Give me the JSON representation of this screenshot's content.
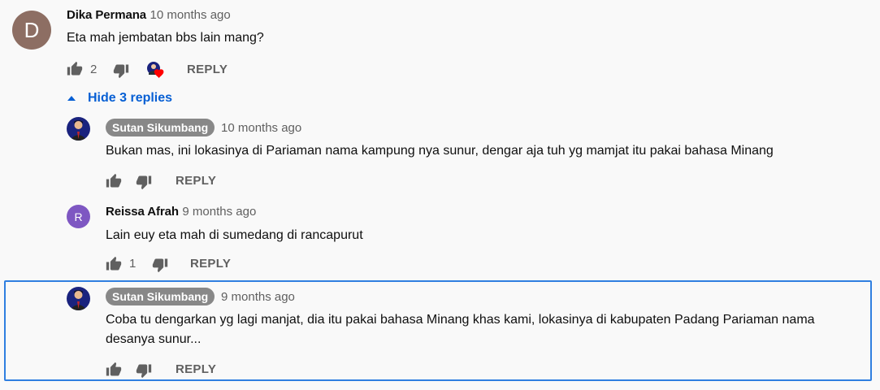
{
  "top_comment": {
    "avatar_letter": "D",
    "author": "Dika Permana",
    "time": "10 months ago",
    "text": "Eta mah jembatan bbs lain mang?",
    "likes": "2",
    "reply_label": "REPLY"
  },
  "hide_replies_label": "Hide 3 replies",
  "replies": [
    {
      "author": "Sutan Sikumbang",
      "time": "10 months ago",
      "text": "Bukan mas, ini lokasinya di Pariaman nama kampung nya sunur, dengar aja tuh yg mamjat itu pakai bahasa Minang",
      "reply_label": "REPLY"
    },
    {
      "avatar_letter": "R",
      "author": "Reissa Afrah",
      "time": "9 months ago",
      "text": "Lain euy eta mah di sumedang di rancapurut",
      "likes": "1",
      "reply_label": "REPLY"
    },
    {
      "author": "Sutan Sikumbang",
      "time": "9 months ago",
      "text_line1": "Coba tu dengarkan yg lagi manjat, dia itu pakai bahasa Minang khas kami, lokasinya di kabupaten Padang Pariaman nama",
      "text_line2": "desanya sunur...",
      "reply_label": "REPLY"
    }
  ],
  "colors": {
    "link_blue": "#065fd4",
    "highlight_border": "#2f7fe0",
    "badge_gray": "#888888",
    "heart_red": "#ff0000"
  }
}
